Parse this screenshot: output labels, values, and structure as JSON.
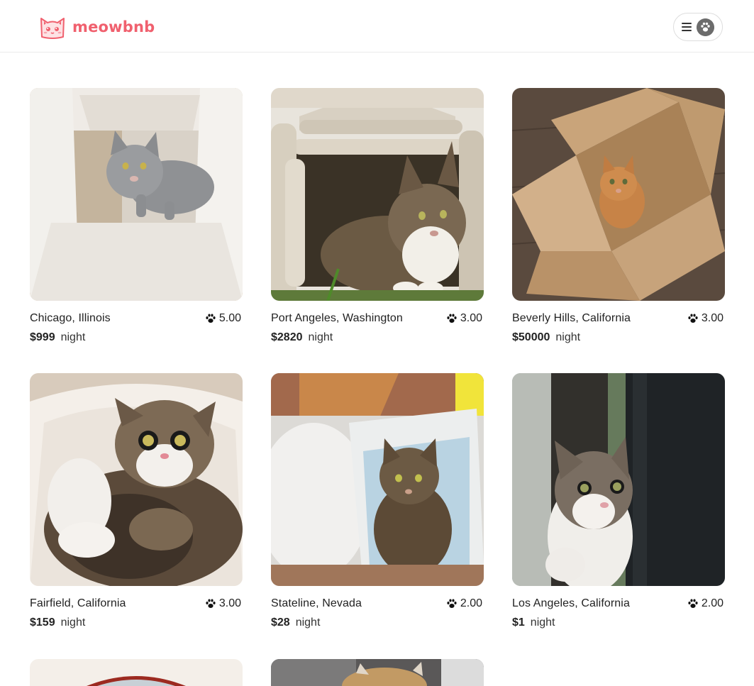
{
  "brand": {
    "name": "meowbnb",
    "color": "#f0606e"
  },
  "header": {
    "menu_icon": "hamburger-icon",
    "avatar_icon": "cat-paw-avatar-icon"
  },
  "listings": [
    {
      "location": "Chicago, Illinois",
      "rating": "5.00",
      "price": "$999",
      "unit": "night",
      "photo": "gray cat walking through a cardboard box"
    },
    {
      "location": "Port Angeles, Washington",
      "rating": "3.00",
      "price": "$2820",
      "unit": "night",
      "photo": "tabby cat in a birch log house"
    },
    {
      "location": "Beverly Hills, California",
      "rating": "3.00",
      "price": "$50000",
      "unit": "night",
      "photo": "orange cat sitting in a cardboard box"
    },
    {
      "location": "Fairfield, California",
      "rating": "3.00",
      "price": "$159",
      "unit": "night",
      "photo": "surprised tabby cat in a white bed"
    },
    {
      "location": "Stateline, Nevada",
      "rating": "2.00",
      "price": "$28",
      "unit": "night",
      "photo": "tabby cat in a litter box"
    },
    {
      "location": "Los Angeles, California",
      "rating": "2.00",
      "price": "$1",
      "unit": "night",
      "photo": "cat peeking behind a door"
    }
  ],
  "colors": {
    "text": "#222222",
    "border": "#dddddd",
    "divider": "#ebebeb"
  }
}
